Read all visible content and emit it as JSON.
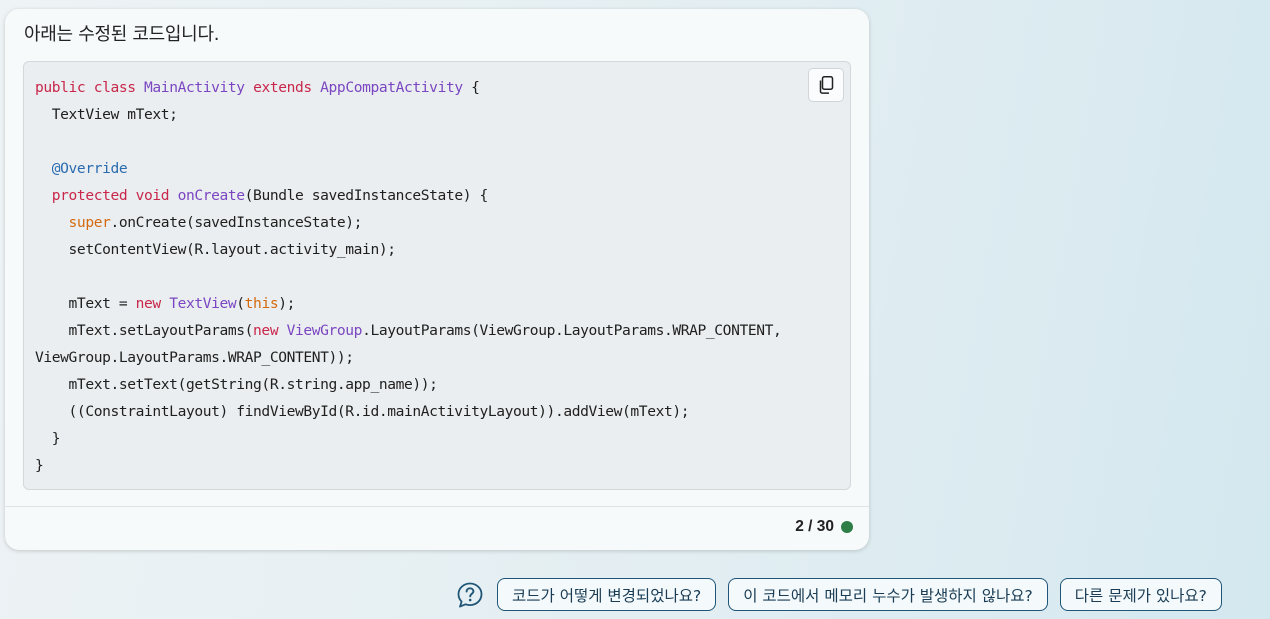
{
  "message": {
    "intro": "아래는 수정된 코드입니다.",
    "code_lines": [
      [
        {
          "t": "public class ",
          "c": "kw"
        },
        {
          "t": "MainActivity ",
          "c": "ty"
        },
        {
          "t": "extends ",
          "c": "kw"
        },
        {
          "t": "AppCompatActivity",
          "c": "ty"
        },
        {
          "t": " {",
          "c": ""
        }
      ],
      [
        {
          "t": "  TextView mText;",
          "c": ""
        }
      ],
      [],
      [
        {
          "t": "  @Override",
          "c": "an"
        }
      ],
      [
        {
          "t": "  protected void ",
          "c": "kw"
        },
        {
          "t": "onCreate",
          "c": "ty"
        },
        {
          "t": "(Bundle savedInstanceState) {",
          "c": ""
        }
      ],
      [
        {
          "t": "    ",
          "c": ""
        },
        {
          "t": "super",
          "c": "sp"
        },
        {
          "t": ".onCreate(savedInstanceState);",
          "c": ""
        }
      ],
      [
        {
          "t": "    setContentView(R.layout.activity_main);",
          "c": ""
        }
      ],
      [],
      [
        {
          "t": "    mText = ",
          "c": ""
        },
        {
          "t": "new ",
          "c": "kw"
        },
        {
          "t": "TextView",
          "c": "ty"
        },
        {
          "t": "(",
          "c": ""
        },
        {
          "t": "this",
          "c": "sp"
        },
        {
          "t": ");",
          "c": ""
        }
      ],
      [
        {
          "t": "    mText.setLayoutParams(",
          "c": ""
        },
        {
          "t": "new ",
          "c": "kw"
        },
        {
          "t": "ViewGroup",
          "c": "ty"
        },
        {
          "t": ".LayoutParams(ViewGroup.LayoutParams.WRAP_CONTENT,",
          "c": ""
        }
      ],
      [
        {
          "t": "ViewGroup.LayoutParams.WRAP_CONTENT));",
          "c": ""
        }
      ],
      [
        {
          "t": "    mText.setText(getString(R.string.app_name));",
          "c": ""
        }
      ],
      [
        {
          "t": "    ((ConstraintLayout) findViewById(R.id.mainActivityLayout)).addView(mText);",
          "c": ""
        }
      ],
      [
        {
          "t": "  }",
          "c": ""
        }
      ],
      [
        {
          "t": "}",
          "c": ""
        }
      ]
    ],
    "copy_icon": "copy-icon",
    "response_count": "2 / 30",
    "status_color": "#2d7d46"
  },
  "suggestions": {
    "help_icon": "question-chat-icon",
    "chips": [
      "코드가 어떻게 변경되었나요?",
      "이 코드에서 메모리 누수가 발생하지 않나요?",
      "다른 문제가 있나요?"
    ]
  },
  "colors": {
    "keyword": "#c8274b",
    "type": "#7a46c2",
    "annotation": "#2a6cb0",
    "special": "#d46a10",
    "chip_border": "#1f5576"
  }
}
